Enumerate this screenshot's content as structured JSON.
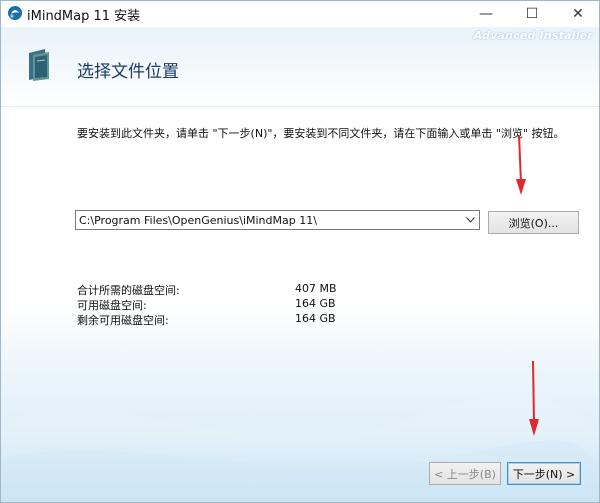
{
  "window": {
    "title": "iMindMap 11 安装",
    "min_label": "—",
    "max_label": "☐",
    "close_label": "✕"
  },
  "header": {
    "brand": "Advanced Installer",
    "title": "选择文件位置"
  },
  "instructions": "要安装到此文件夹，请单击 \"下一步(N)\"，要安装到不同文件夹，请在下面输入或单击 \"浏览\" 按钮。",
  "install_path": {
    "value": "C:\\Program Files\\OpenGenius\\iMindMap 11\\"
  },
  "buttons": {
    "browse": "浏览(O)...",
    "back": "< 上一步(B)",
    "next": "下一步(N) >"
  },
  "disk_space": [
    {
      "label": "合计所需的磁盘空间:",
      "value": "407 MB"
    },
    {
      "label": "可用磁盘空间:",
      "value": "164 GB"
    },
    {
      "label": "剩余可用磁盘空间:",
      "value": "164 GB"
    }
  ],
  "colors": {
    "accent": "#4a90c9",
    "header_bg": "#e9f3fa",
    "annotation_arrow": "#e0282e"
  },
  "icons": {
    "app": "imindmap-app-icon",
    "header": "folder-icon",
    "combo": "chevron-down-icon"
  }
}
